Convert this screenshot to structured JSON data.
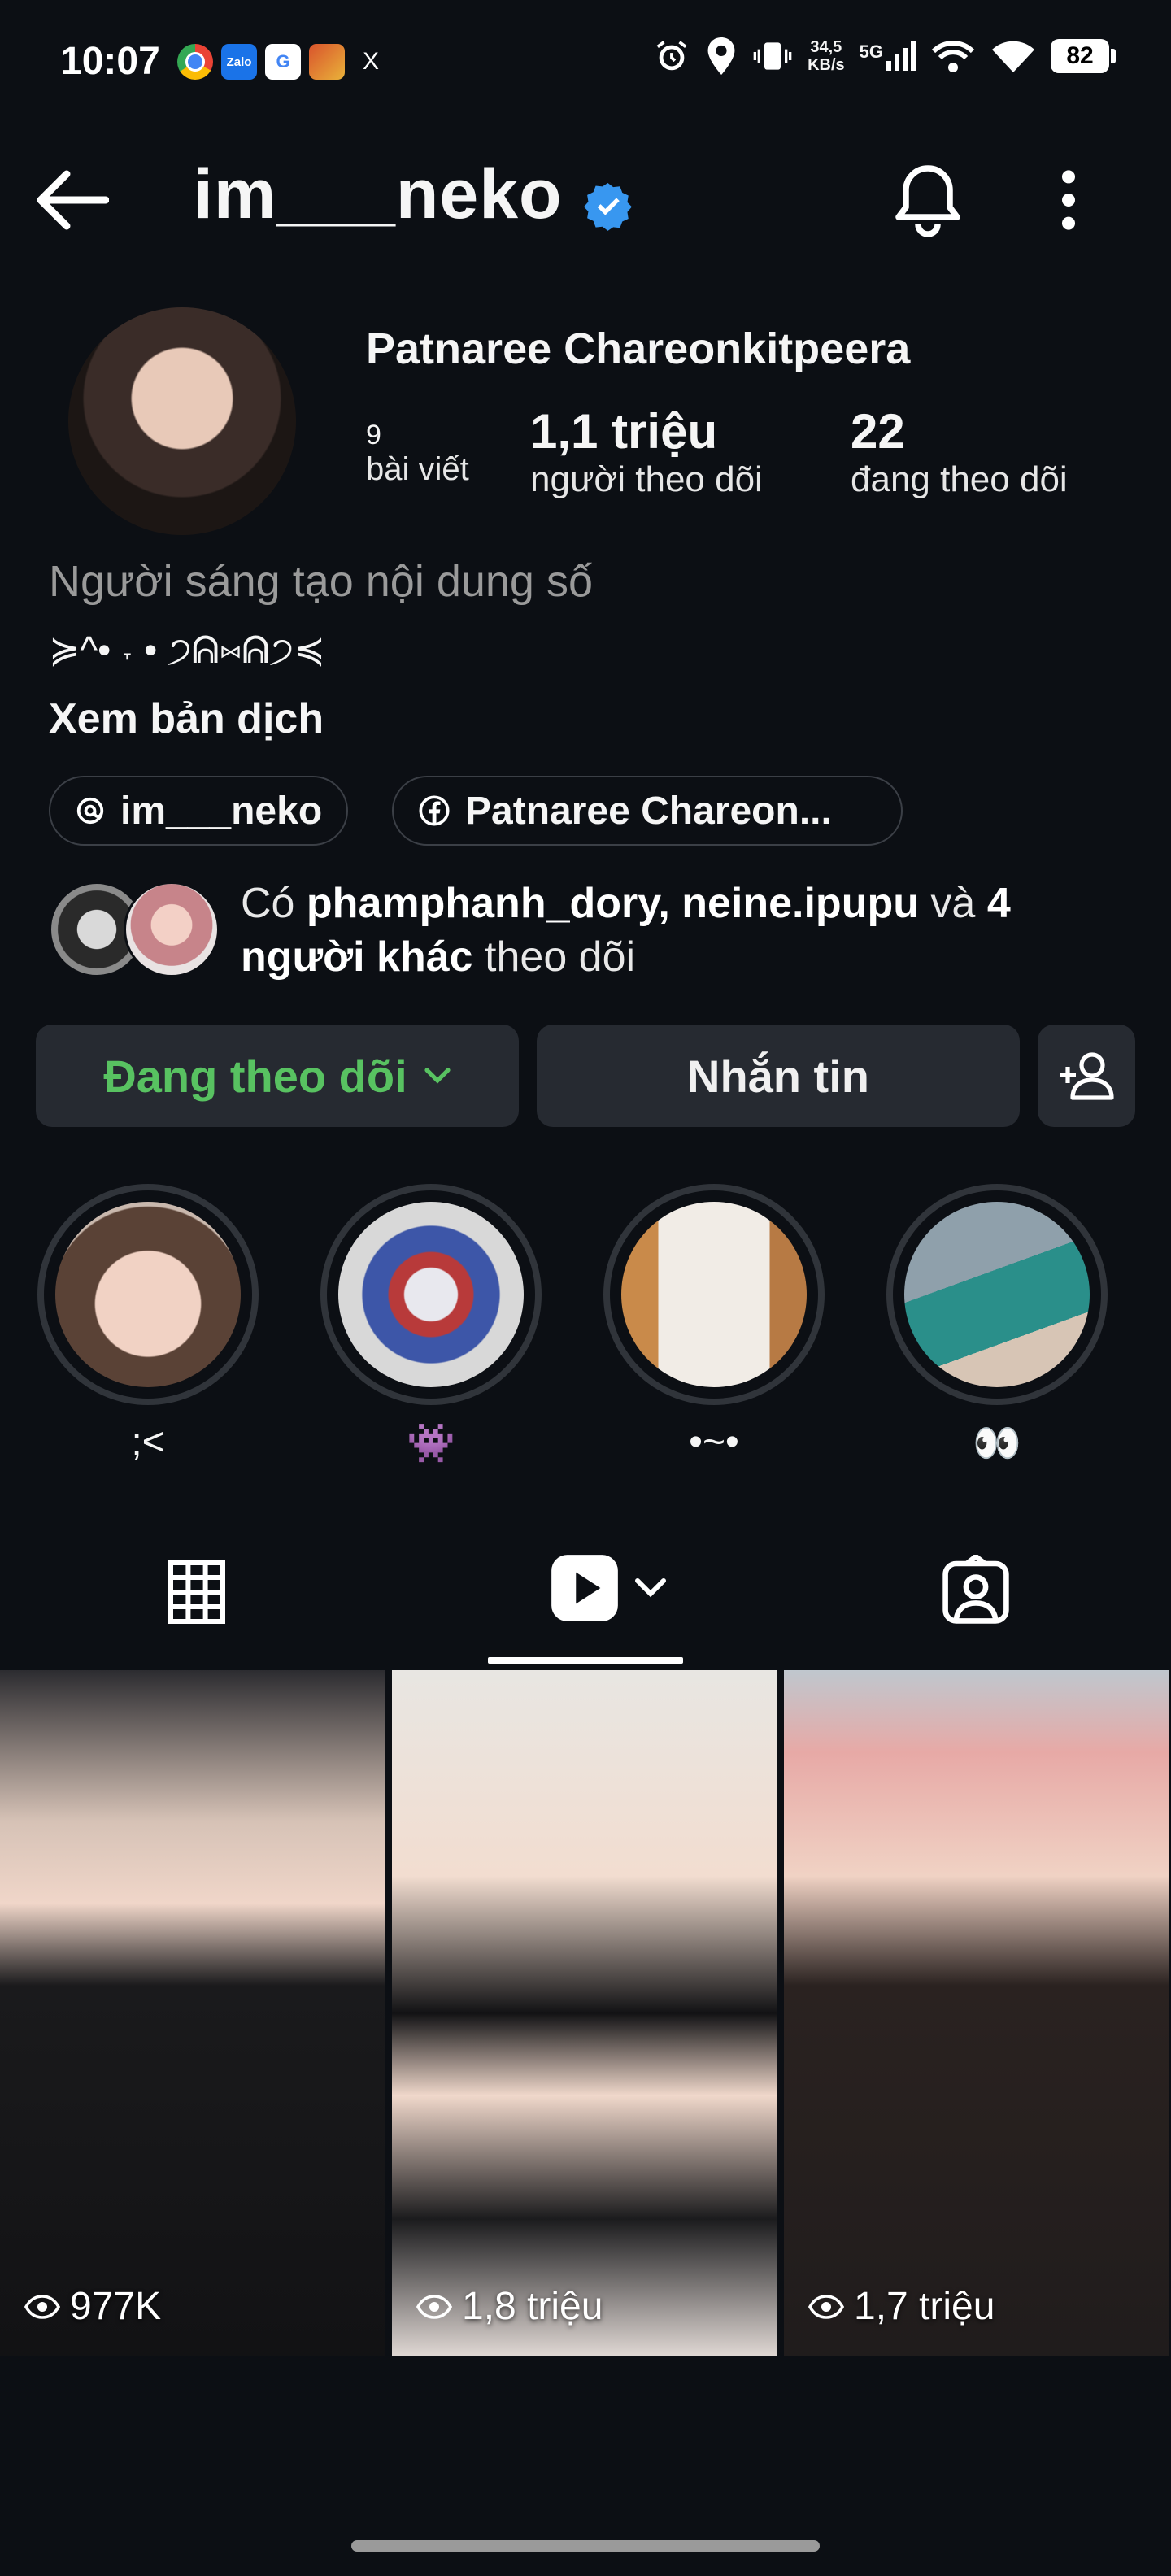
{
  "status": {
    "time": "10:07",
    "apps": [
      "chrome",
      "Zalo",
      "G",
      "game",
      "X"
    ],
    "net_speed_top": "34,5",
    "net_speed_unit": "KB/s",
    "network": "5G",
    "battery": "82"
  },
  "header": {
    "username": "im___neko",
    "icons": [
      "back-arrow-icon",
      "verified-badge-icon",
      "bell-icon",
      "more-vertical-icon"
    ]
  },
  "profile": {
    "full_name": "Patnaree Chareonkitpeera",
    "posts_count": "9",
    "posts_label": "bài viết",
    "followers_count": "1,1 triệu",
    "followers_label": "người theo dõi",
    "following_count": "22",
    "following_label": "đang theo dõi",
    "category": "Người sáng tạo nội dung số",
    "bio": "≽^•  ˕  • ੭ᕱ⑅ᕱ੭≼",
    "translate_label": "Xem bản dịch"
  },
  "links": [
    {
      "icon": "threads-icon",
      "label": "im___neko"
    },
    {
      "icon": "facebook-icon",
      "label": "Patnaree Chareon..."
    }
  ],
  "mutual": {
    "prefix": "Có ",
    "names": "phamphanh_dory, neine.ipupu",
    "middle": " và ",
    "others": "4 người khác",
    "suffix": " theo dõi"
  },
  "actions": {
    "following_label": "Đang theo dõi",
    "message_label": "Nhắn tin"
  },
  "highlights": [
    {
      "label": ";<"
    },
    {
      "label": "👾"
    },
    {
      "label": "•~•"
    },
    {
      "label": "👀"
    }
  ],
  "tabs": [
    "grid-icon",
    "reels-icon",
    "tagged-icon"
  ],
  "reels": [
    {
      "views": "977K"
    },
    {
      "views": "1,8 triệu"
    },
    {
      "views": "1,7 triệu"
    }
  ],
  "colors": {
    "background": "#0c0f14",
    "following_green": "#58c261",
    "verified_blue": "#3897f0",
    "button_bg": "#262a31"
  }
}
